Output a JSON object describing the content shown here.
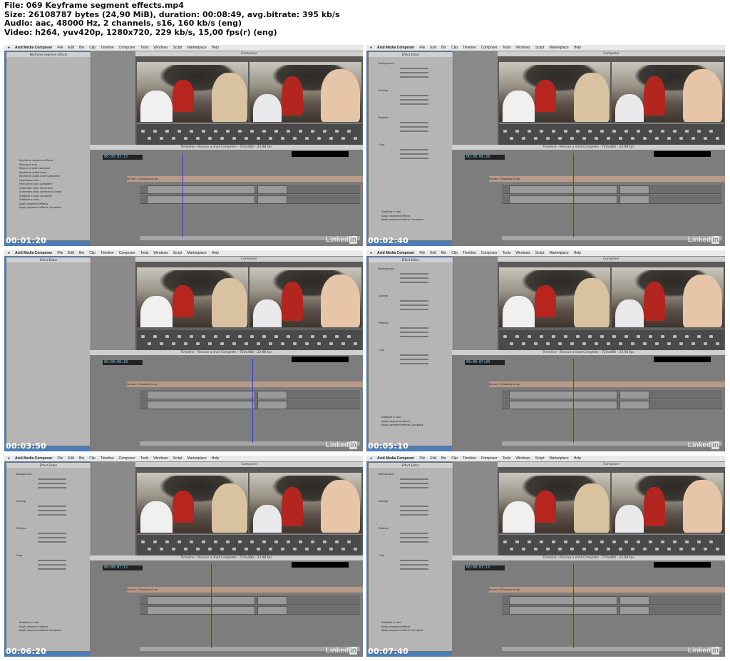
{
  "header": {
    "file": "File: 069 Keyframe segment effects.mp4",
    "size": "Size: 26108787 bytes (24,90 MiB), duration: 00:08:49, avg.bitrate: 395 kb/s",
    "audio": "Audio: aac, 48000 Hz, 2 channels, s16, 160 kb/s (eng)",
    "video": "Video: h264, yuv420p, 1280x720, 229 kb/s, 15,00 fps(r) (eng)"
  },
  "menubar": {
    "app": "Avid Media Composer",
    "items": [
      "File",
      "Edit",
      "Bin",
      "Clip",
      "Timeline",
      "Composer",
      "Tools",
      "Windows",
      "Script",
      "Marketplace",
      "Help"
    ]
  },
  "composer_title": "Composer",
  "timeline_title": "Timeline - Rescue a shot Complete - 720x480 - 23.98 fps",
  "bin_items": [
    "Keyframe segment effects",
    "Rescue a shot",
    "Rescue a shot Complete",
    "Keyframe audio level",
    "Keyframe audio level Complete",
    "Hard jump cuts",
    "Hard jump cuts Complete",
    "Automate color correction",
    "Automate color correction Compl",
    "Stabilize a shot Complete",
    "Stabilize a shot",
    "Apply segment effects",
    "Apply segment effects Complete"
  ],
  "effect_editor": {
    "title": "Effect Editor",
    "groups": [
      "Background",
      "Scaling",
      "Position",
      "Crop"
    ]
  },
  "clip_labels": [
    "Maui, Women Lisp",
    "Runner 2 Shooting at car",
    "Maui, Man with kids",
    "Camera"
  ],
  "frames": [
    {
      "timestamp": "00:01:20",
      "timecode": "00:00:03:23"
    },
    {
      "timestamp": "00:02:40",
      "timecode": "00:00:06:20"
    },
    {
      "timestamp": "00:03:50",
      "timecode": "00:00:06:20"
    },
    {
      "timestamp": "00:05:10",
      "timecode": "00:00:07:04"
    },
    {
      "timestamp": "00:06:20",
      "timecode": "00:00:07:12"
    },
    {
      "timestamp": "00:07:40",
      "timecode": "00:00:07:13"
    }
  ],
  "watermark": "Linked",
  "watermark_in": "in"
}
